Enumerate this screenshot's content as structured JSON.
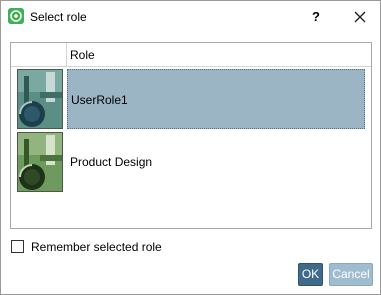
{
  "dialog": {
    "title": "Select role",
    "help_label": "?",
    "icons": {
      "app": "app-logo-icon",
      "close": "close-icon"
    }
  },
  "table": {
    "columns": [
      "",
      "Role"
    ],
    "rows": [
      {
        "label": "UserRole1",
        "selected": true,
        "thumbnail": "role-thumbnail-icon"
      },
      {
        "label": "Product Design",
        "selected": false,
        "thumbnail": "role-thumbnail-icon"
      }
    ]
  },
  "remember": {
    "label": "Remember selected role",
    "checked": false
  },
  "buttons": {
    "ok": "OK",
    "cancel": "Cancel"
  },
  "colors": {
    "selection": "#9cb5c4",
    "ok_button": "#3f6a8a",
    "cancel_button": "#9fbcd1",
    "app_icon": "#3fae55"
  }
}
